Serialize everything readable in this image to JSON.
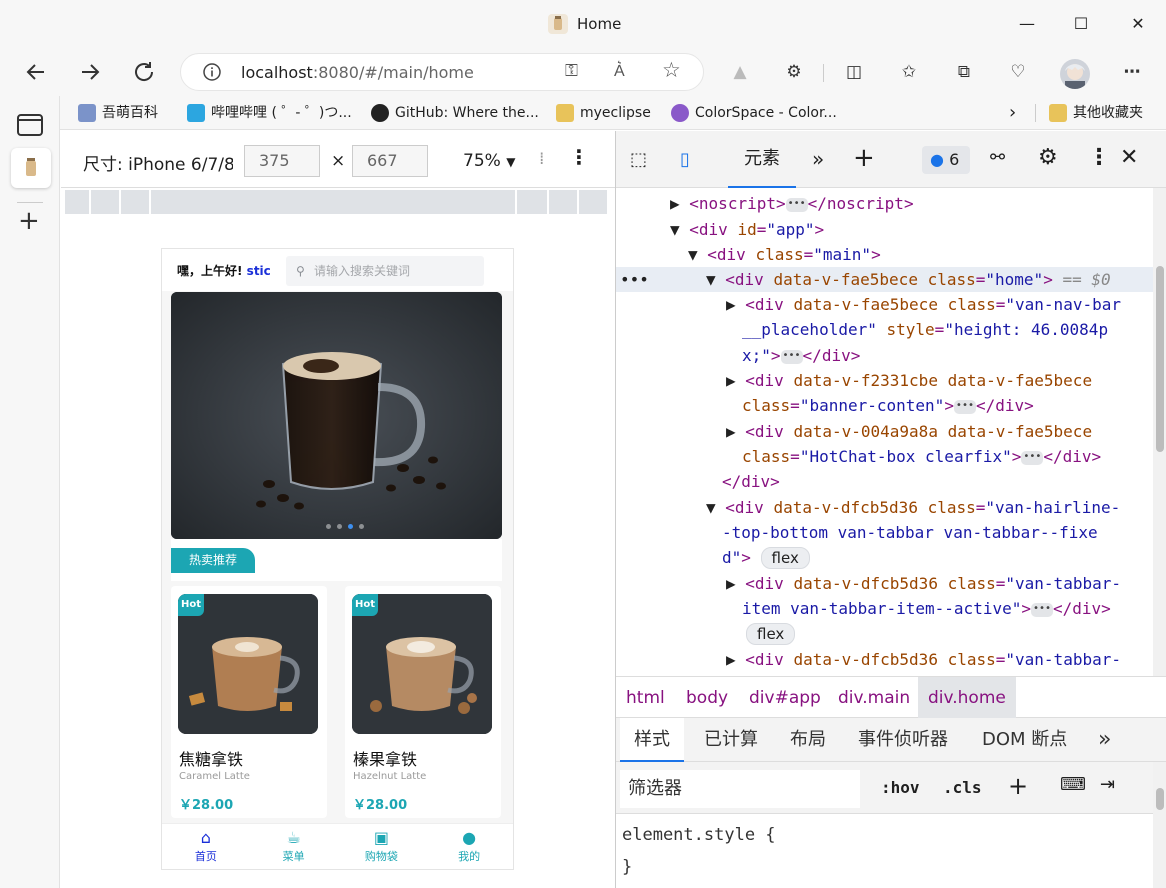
{
  "window": {
    "title": "Home",
    "minimize": "—",
    "maximize": "☐",
    "close": "✕"
  },
  "address": {
    "host": "localhost",
    "rest": ":8080/#/main/home",
    "info_icon": "info-icon"
  },
  "bookmarks": [
    {
      "label": "吾萌百科",
      "color": "#7b93c9"
    },
    {
      "label": "哔哩哔哩 ( ゜- ゜)つ...",
      "color": "#2ca6e0"
    },
    {
      "label": "GitHub: Where the...",
      "color": "#222222"
    },
    {
      "label": "myeclipse",
      "color": "#e8c35a"
    },
    {
      "label": "ColorSpace - Color...",
      "color": "#8a59c9"
    },
    {
      "label": "其他收藏夹",
      "color": "#e8c35a"
    }
  ],
  "device": {
    "label": "尺寸: iPhone 6/7/8",
    "width": "375",
    "times": "×",
    "height": "667",
    "zoom": "75%"
  },
  "phone": {
    "greeting": "嘿，上午好!",
    "name": "stic",
    "search_placeholder": "请输入搜索关键词",
    "hot_tag": "热卖推荐",
    "banner_dots": 4,
    "banner_active": 2,
    "products": [
      {
        "badge": "Hot",
        "name": "焦糖拿铁",
        "en": "Caramel Latte",
        "price": "￥28.00"
      },
      {
        "badge": "Hot",
        "name": "榛果拿铁",
        "en": "Hazelnut Latte",
        "price": "￥28.00"
      }
    ],
    "tabs": [
      {
        "label": "首页",
        "active": true
      },
      {
        "label": "菜单",
        "active": false
      },
      {
        "label": "购物袋",
        "active": false
      },
      {
        "label": "我的",
        "active": false
      }
    ]
  },
  "devtools": {
    "tab_elements": "元素",
    "issues_count": "6",
    "dom_lines": [
      {
        "t": "▶ <noscript>",
        "x": 56
      },
      {
        "t": "<div id=\"app\">"
      },
      {
        "t": "<div class=\"main\">"
      },
      {
        "t": "<div data-v-fae5bece class=\"home\"> == $0"
      }
    ],
    "breadcrumbs": [
      "html",
      "body",
      "div#app",
      "div.main",
      "div.home"
    ],
    "style_tabs": [
      "样式",
      "已计算",
      "布局",
      "事件侦听器",
      "DOM 断点"
    ],
    "filter_placeholder": "筛选器",
    "hov": ":hov",
    "cls": ".cls",
    "element_style": "element.style {",
    "element_style_close": "}"
  }
}
